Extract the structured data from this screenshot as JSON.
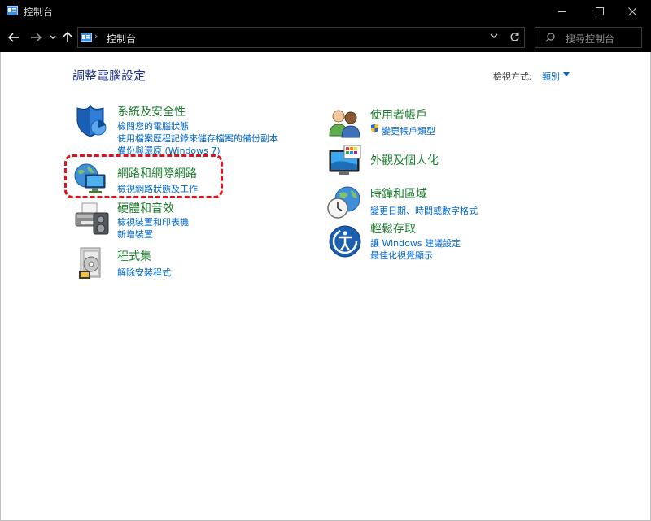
{
  "window": {
    "title": "控制台",
    "minimize_glyph": "—",
    "maximize_glyph": "☐",
    "close_glyph": "✕"
  },
  "nav": {
    "back_glyph": "←",
    "forward_glyph": "→",
    "recent_glyph": "˅",
    "up_glyph": "↑",
    "breadcrumb_sep": "›",
    "breadcrumb": "控制台",
    "search_placeholder": "搜尋控制台"
  },
  "main": {
    "title": "調整電腦設定",
    "view_by_label": "檢視方式:",
    "view_by_value": "類別"
  },
  "categories_left": [
    {
      "title": "系統及安全性",
      "icon": "shield-icon",
      "links": [
        "檢閱您的電腦狀態",
        "使用檔案歷程記錄來儲存檔案的備份副本",
        "備份與還原 (Windows 7)"
      ]
    },
    {
      "title": "網路和網際網路",
      "icon": "network-globe-icon",
      "links": [
        "檢視網路狀態及工作"
      ]
    },
    {
      "title": "硬體和音效",
      "icon": "printer-icon",
      "links": [
        "檢視裝置和印表機",
        "新增裝置"
      ]
    },
    {
      "title": "程式集",
      "icon": "programs-icon",
      "links": [
        "解除安裝程式"
      ]
    }
  ],
  "categories_right": [
    {
      "title": "使用者帳戶",
      "icon": "users-icon",
      "links": [
        "變更帳戶類型"
      ]
    },
    {
      "title": "外觀及個人化",
      "icon": "monitor-palette-icon",
      "links": []
    },
    {
      "title": "時鐘和區域",
      "icon": "clock-globe-icon",
      "links": [
        "變更日期、時間或數字格式"
      ]
    },
    {
      "title": "輕鬆存取",
      "icon": "ease-of-access-icon",
      "links": [
        "讓 Windows 建議設定",
        "最佳化視覺顯示"
      ]
    }
  ]
}
